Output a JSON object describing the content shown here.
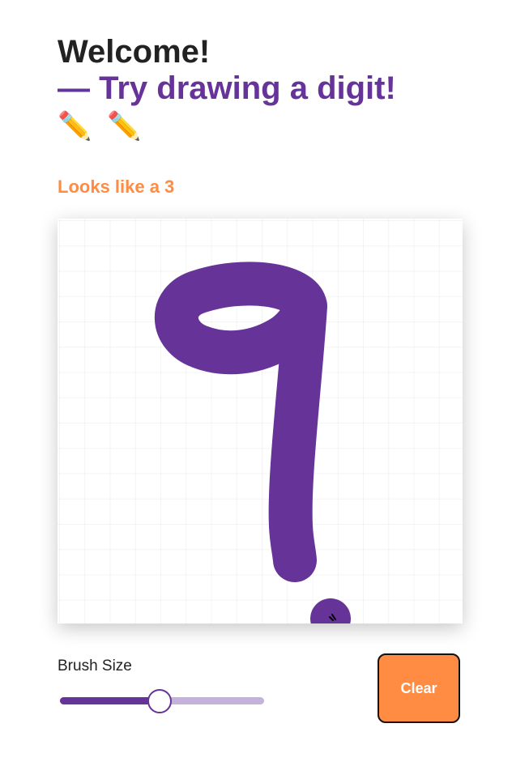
{
  "header": {
    "welcome": "Welcome!",
    "prompt": "— Try drawing a digit!",
    "pencil_icons": "✏️ ✏️"
  },
  "prediction": {
    "text": "Looks like a 3"
  },
  "canvas": {
    "stroke_color": "#663399",
    "grid": true
  },
  "controls": {
    "brush_size_label": "Brush Size",
    "brush_size_fraction": 0.49,
    "clear_label": "Clear"
  },
  "colors": {
    "accent_purple": "#663399",
    "accent_orange": "#ff8c42",
    "text_dark": "#222222"
  }
}
